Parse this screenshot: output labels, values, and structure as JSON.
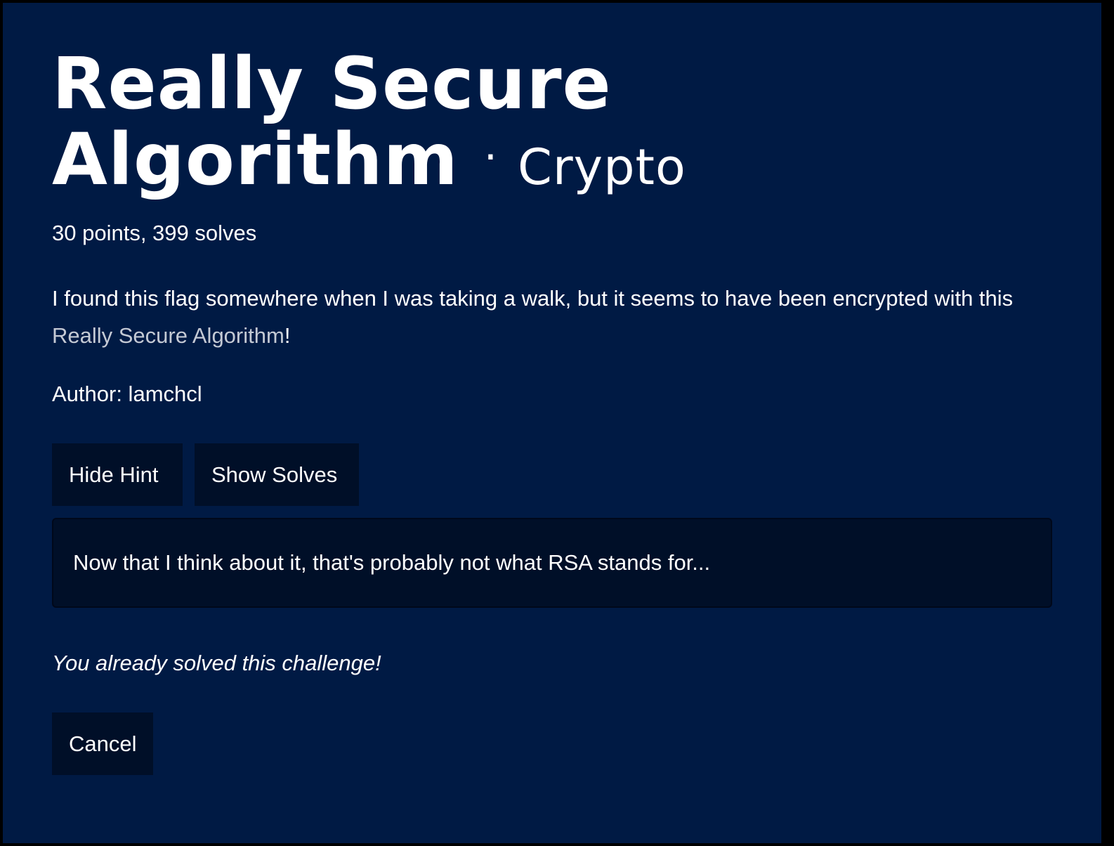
{
  "challenge": {
    "title_line1": "Really Secure",
    "title_line2": "Algorithm",
    "separator": "·",
    "category": "Crypto",
    "meta": "30 points, 399 solves",
    "description_prefix": "I found this flag somewhere when I was taking a walk, but it seems to have been encrypted with this ",
    "description_link": "Really Secure Algorithm",
    "description_suffix": "!",
    "author": "Author: lamchcl"
  },
  "buttons": {
    "hide_hint": "Hide Hint",
    "show_solves": "Show Solves",
    "cancel": "Cancel"
  },
  "hint": {
    "text": "Now that I think about it, that's probably not what RSA stands for..."
  },
  "status": {
    "solved_message": "You already solved this challenge!"
  },
  "colors": {
    "modal_background": "#001a44",
    "button_background": "#000f28",
    "link": "#c4c9d4",
    "text": "#ffffff"
  }
}
